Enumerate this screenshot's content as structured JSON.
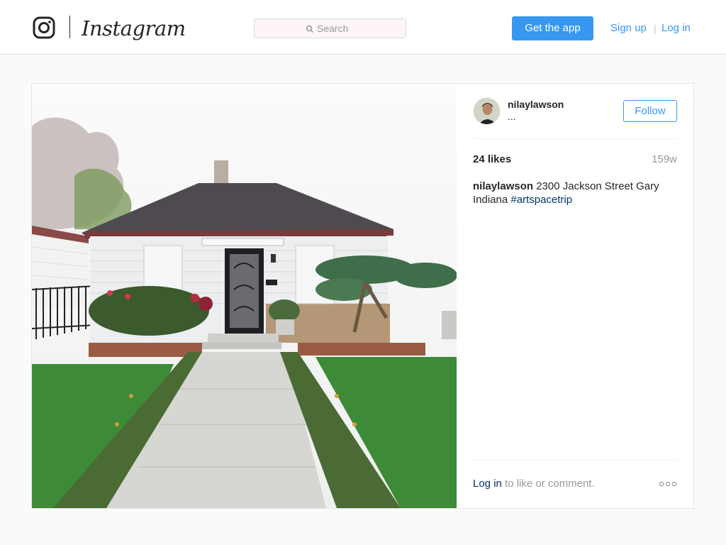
{
  "header": {
    "brand": "Instagram",
    "search": {
      "placeholder": "Search",
      "value": ""
    },
    "get_app_label": "Get the app",
    "signup_label": "Sign up",
    "separator": "|",
    "login_label": "Log in"
  },
  "post": {
    "username": "nilaylawson",
    "location": "...",
    "follow_label": "Follow",
    "likes": "24 likes",
    "age": "159w",
    "caption": {
      "username": "nilaylawson",
      "text": " 2300 Jackson Street Gary Indiana ",
      "hashtag": "#artspacetrip"
    },
    "comment_prompt": {
      "link": "Log in",
      "text": " to like or comment."
    }
  },
  "colors": {
    "accent": "#3897f0",
    "hashtag": "#003569",
    "muted": "#999999"
  }
}
